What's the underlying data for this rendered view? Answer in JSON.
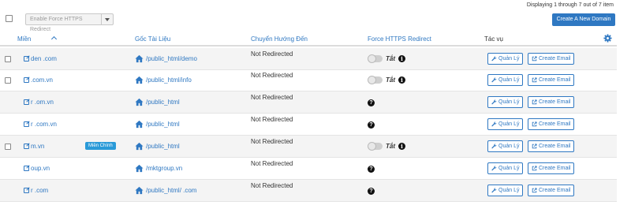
{
  "toolbar": {
    "bulk_action_label": "Enable Force HTTPS Redirect",
    "display_count": "Displaying 1 through 7 out of 7 item",
    "create_domain_label": "Create A New Domain"
  },
  "columns": {
    "domain": "Miền",
    "document_root": "Gốc Tài Liệu",
    "redirect": "Chuyển Hướng Đến",
    "force_https": "Force HTTPS Redirect",
    "actions": "Tác vụ"
  },
  "labels": {
    "manage": "Quản Lý",
    "create_email": "Create Email",
    "toggle_off": "Tắt",
    "info_glyph": "i",
    "help_glyph": "?"
  },
  "rows": [
    {
      "domain": "den          .com",
      "docroot": "/public_html/demo",
      "redirect": "Not Redirected",
      "checkbox": true,
      "https": "toggle",
      "badge": ""
    },
    {
      "domain": "                 .com.vn",
      "docroot": "/public_html/info",
      "redirect": "Not Redirected",
      "checkbox": true,
      "https": "toggle",
      "badge": ""
    },
    {
      "domain": "r            .om.vn",
      "docroot": "/public_html",
      "redirect": "Not Redirected",
      "checkbox": false,
      "https": "help",
      "badge": ""
    },
    {
      "domain": "r              .com.vn",
      "docroot": "/public_html",
      "redirect": "Not Redirected",
      "checkbox": false,
      "https": "help",
      "badge": ""
    },
    {
      "domain": "                 m.vn",
      "docroot": "/public_html",
      "redirect": "Not Redirected",
      "checkbox": true,
      "https": "toggle",
      "badge": "Miền Chính"
    },
    {
      "domain": "               oup.vn",
      "docroot": "/mktgroup.vn",
      "redirect": "Not Redirected",
      "checkbox": false,
      "https": "help",
      "badge": ""
    },
    {
      "domain": "r          .com",
      "docroot": "/public_html/        .com",
      "redirect": "Not Redirected",
      "checkbox": false,
      "https": "help",
      "badge": ""
    }
  ],
  "colors": {
    "accent": "#2f78c2",
    "badge": "#2a9ad8",
    "row_alt": "#f4f4f4"
  }
}
